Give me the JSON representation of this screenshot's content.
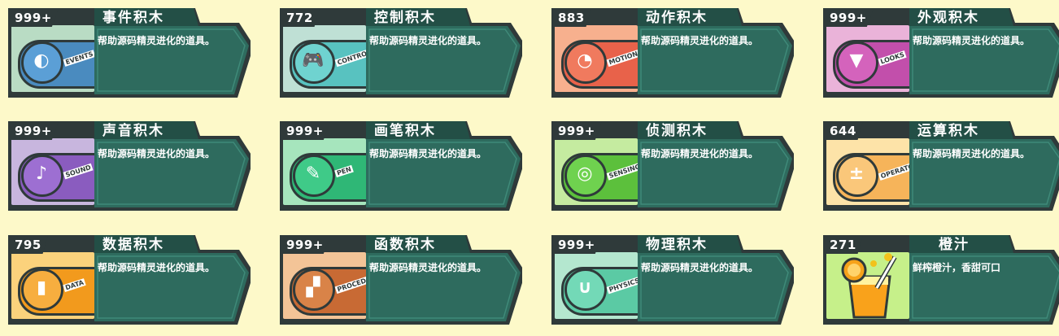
{
  "items": [
    {
      "count": "999+",
      "title": "事件积木",
      "desc": "帮助源码精灵进化的道具。",
      "label": "EVENTS",
      "icon_name": "toggle-icon",
      "bg": "#b9dcc4",
      "key": "#4a8bbf",
      "circle": "#5b9fd6",
      "glyph": "◐"
    },
    {
      "count": "772",
      "title": "控制积木",
      "desc": "帮助源码精灵进化的道具。",
      "label": "CONTRO",
      "icon_name": "gamepad-icon",
      "bg": "#bfe0d5",
      "key": "#58c2c0",
      "circle": "#6fd3d0",
      "glyph": "🎮"
    },
    {
      "count": "883",
      "title": "动作积木",
      "desc": "帮助源码精灵进化的道具。",
      "label": "MOTION",
      "icon_name": "ghost-icon",
      "bg": "#f7b08e",
      "key": "#e8624a",
      "circle": "#f07a5e",
      "glyph": "◔"
    },
    {
      "count": "999+",
      "title": "外观积木",
      "desc": "帮助源码精灵进化的道具。",
      "label": "LOOKS",
      "icon_name": "shirt-icon",
      "bg": "#eab3d9",
      "key": "#c24fab",
      "circle": "#d463bc",
      "glyph": "▼"
    },
    {
      "count": "999+",
      "title": "声音积木",
      "desc": "帮助源码精灵进化的道具。",
      "label": "SOUND",
      "icon_name": "microphone-icon",
      "bg": "#c8b6de",
      "key": "#8a5cbf",
      "circle": "#9d6fd2",
      "glyph": "♪"
    },
    {
      "count": "999+",
      "title": "画笔积木",
      "desc": "帮助源码精灵进化的道具。",
      "label": "PEN",
      "icon_name": "pen-icon",
      "bg": "#a6e5bd",
      "key": "#2fb776",
      "circle": "#3fca88",
      "glyph": "✎"
    },
    {
      "count": "999+",
      "title": "侦测积木",
      "desc": "帮助源码精灵进化的道具。",
      "label": "SENSING",
      "icon_name": "target-icon",
      "bg": "#c5eba0",
      "key": "#5cc03c",
      "circle": "#6fd24f",
      "glyph": "◎"
    },
    {
      "count": "644",
      "title": "运算积木",
      "desc": "帮助源码精灵进化的道具。",
      "label": "OPERATO",
      "icon_name": "calculator-icon",
      "bg": "#fde3a8",
      "key": "#f6b45a",
      "circle": "#fac77a",
      "glyph": "±"
    },
    {
      "count": "795",
      "title": "数据积木",
      "desc": "帮助源码精灵进化的道具。",
      "label": "DATA",
      "icon_name": "bar-chart-icon",
      "bg": "#fbd27c",
      "key": "#f29a1d",
      "circle": "#f7ae3f",
      "glyph": "▮"
    },
    {
      "count": "999+",
      "title": "函数积木",
      "desc": "帮助源码精灵进化的道具。",
      "label": "PROCED",
      "icon_name": "blocks-icon",
      "bg": "#f3c497",
      "key": "#c86a34",
      "circle": "#d98348",
      "glyph": "▞"
    },
    {
      "count": "999+",
      "title": "物理积木",
      "desc": "帮助源码精灵进化的道具。",
      "label": "PHYSICS",
      "icon_name": "magnet-icon",
      "bg": "#b4e7cf",
      "key": "#5bcaa4",
      "circle": "#73d9b7",
      "glyph": "∪"
    },
    {
      "count": "271",
      "title": "橙汁",
      "desc": "鲜榨橙汁，香甜可口",
      "label": "",
      "icon_name": "orange-juice-icon",
      "bg": "#c6f08a",
      "key": "",
      "circle": "",
      "glyph": ""
    }
  ],
  "colors": {
    "frame": "#2f3a3a",
    "panel": "#2e6b5e",
    "panel_dark": "#234f46",
    "page_bg": "#fdf9c9"
  }
}
